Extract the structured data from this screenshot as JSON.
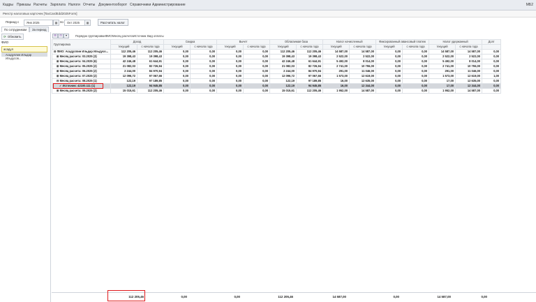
{
  "menubar": {
    "items": [
      "Кадры",
      "Приказы",
      "Расчеты",
      "Зарплата",
      "Налоги",
      "Отчеты",
      "Документооборот",
      "Справочники",
      "Администрирование"
    ],
    "right_text": "МБ2"
  },
  "document_title": "Реестр налоговых карточек [TaxCardEdd2025Form]",
  "toolbar": {
    "period_label": "Период с",
    "date_from": "Янв 2025",
    "to_label": "по",
    "date_to": "Окт 2025",
    "calc_button": "Рассчитать налог"
  },
  "tabs": [
    "По сотрудникам",
    "За период"
  ],
  "left_panel": {
    "refresh_label": "Обновить",
    "fio_label": "ФИО",
    "search_value": "асадул",
    "employee": "Асадуллин Ильдар Ильдусов..."
  },
  "grid_toolbar": {
    "group_order_label": "Порядок группировки:",
    "group_items": [
      "ФИО",
      "Месяц расчета",
      "Источник",
      "Вид оплаты"
    ]
  },
  "grid": {
    "group_header": [
      "Группировка",
      "Доход",
      "Скидка",
      "Вычет",
      "Облагаемая база",
      "Налог начисленный",
      "Фиксированный авансовый платеж",
      "Налог удержанный",
      "Долг"
    ],
    "sub_header": [
      "текущий",
      "с начала года"
    ],
    "rows": [
      {
        "label": "⊟ ФИО: Асадуллин Ильдар Ильдусо...",
        "vals": [
          "112 205,46",
          "112 205,46",
          "0,00",
          "0,00",
          "0,00",
          "0,00",
          "112 205,46",
          "112 205,46",
          "14 587,00",
          "14 587,00",
          "0,00",
          "0,00",
          "14 587,00",
          "14 587,00",
          "0,00"
        ],
        "bold": true,
        "indent": 0
      },
      {
        "label": "⊞ Месяц расчета: 03.2025 (3)",
        "vals": [
          "19 398,43",
          "19 398,43",
          "0,00",
          "0,00",
          "0,00",
          "0,00",
          "19 398,43",
          "19 398,43",
          "2 522,00",
          "2 522,00",
          "0,00",
          "0,00",
          "2 522,00",
          "2 522,00",
          "0,00"
        ],
        "bold": true,
        "indent": 1
      },
      {
        "label": "⊞ Месяц расчета: 04.2025 (6)",
        "vals": [
          "42 246,48",
          "61 644,91",
          "0,00",
          "0,00",
          "0,00",
          "0,00",
          "42 246,48",
          "61 644,91",
          "5 492,00",
          "8 014,00",
          "0,00",
          "0,00",
          "5 492,00",
          "8 014,00",
          "0,00"
        ],
        "bold": true,
        "indent": 1
      },
      {
        "label": "⊞ Месяц расчета: 05.2025 (2)",
        "vals": [
          "21 082,03",
          "82 726,94",
          "0,00",
          "0,00",
          "0,00",
          "0,00",
          "21 082,03",
          "82 726,94",
          "2 741,00",
          "10 755,00",
          "0,00",
          "0,00",
          "2 741,00",
          "10 755,00",
          "0,00"
        ],
        "bold": true,
        "indent": 1
      },
      {
        "label": "⊞ Месяц расчета: 06.2025 (2)",
        "vals": [
          "2 244,00",
          "84 970,94",
          "0,00",
          "0,00",
          "0,00",
          "0,00",
          "2 244,00",
          "84 970,94",
          "291,00",
          "11 046,00",
          "0,00",
          "0,00",
          "291,00",
          "11 046,00",
          "0,00"
        ],
        "bold": true,
        "indent": 1
      },
      {
        "label": "⊞ Месяц расчета: 07.2025 (2)",
        "vals": [
          "12 096,72",
          "97 067,66",
          "0,00",
          "0,00",
          "0,00",
          "0,00",
          "12 096,72",
          "97 067,66",
          "1 573,00",
          "12 619,00",
          "0,00",
          "0,00",
          "1 573,00",
          "12 619,00",
          "1,00"
        ],
        "bold": true,
        "indent": 1
      },
      {
        "label": "⊟ Месяц расчета: 08.2025 (1)",
        "vals": [
          "122,19",
          "97 189,85",
          "0,00",
          "0,00",
          "0,00",
          "0,00",
          "122,19",
          "97 189,85",
          "16,00",
          "12 635,00",
          "0,00",
          "0,00",
          "17,00",
          "12 635,00",
          "0,00"
        ],
        "bold": true,
        "indent": 1,
        "boxed": true
      },
      {
        "label": "✓ Источник: 42100.111 (1)",
        "vals": [
          "122,19",
          "94 945,85",
          "0,00",
          "0,00",
          "0,00",
          "0,00",
          "122,19",
          "94 945,85",
          "16,00",
          "12 344,00",
          "0,00",
          "0,00",
          "17,00",
          "12 344,00",
          "0,00"
        ],
        "bold": true,
        "indent": 2,
        "selected": true
      },
      {
        "label": "⊞ Месяц расчета: 09.2025 (2)",
        "vals": [
          "15 015,61",
          "112 205,46",
          "0,00",
          "0,00",
          "0,00",
          "0,00",
          "15 015,61",
          "112 205,46",
          "1 952,00",
          "14 587,00",
          "0,00",
          "0,00",
          "1 952,00",
          "14 587,00",
          "0,00"
        ],
        "bold": true,
        "indent": 1
      }
    ]
  },
  "totals": [
    "112 205,46",
    "0,00",
    "0,00",
    "112 205,46",
    "14 587,00",
    "0,00",
    "14 587,00",
    "0,00"
  ]
}
